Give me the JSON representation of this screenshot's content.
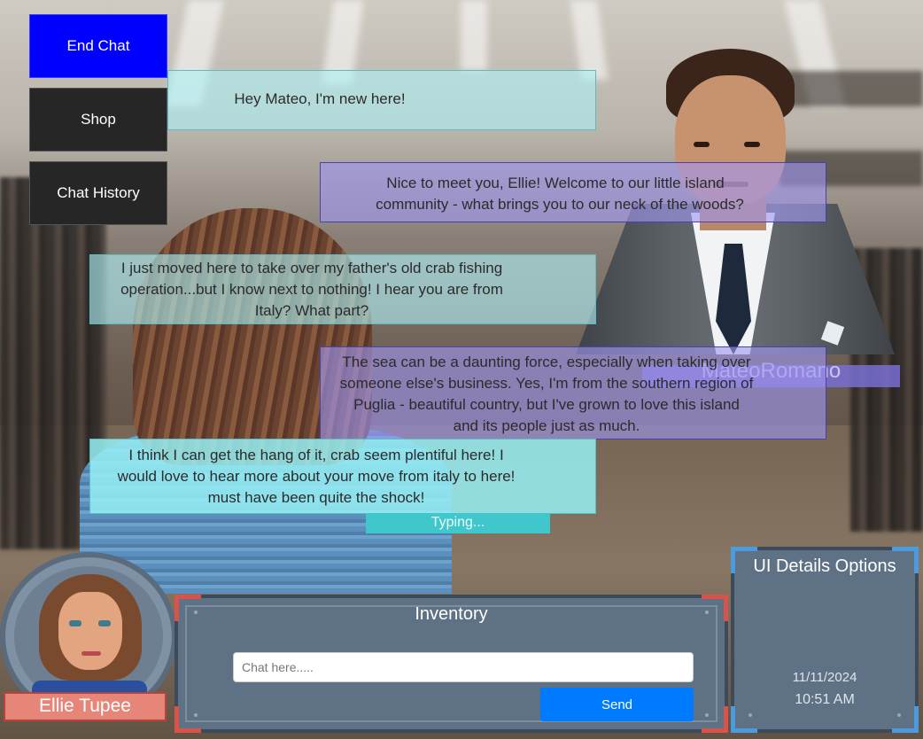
{
  "menu": {
    "end_chat": "End Chat",
    "shop": "Shop",
    "chat_history": "Chat History"
  },
  "chat": {
    "messages": [
      {
        "speaker": "user",
        "lines": [
          "Hey Mateo, I'm new here!"
        ]
      },
      {
        "speaker": "npc",
        "lines": [
          "Nice to meet you, Ellie! Welcome to our little island",
          "community - what brings you to our neck of the woods?"
        ]
      },
      {
        "speaker": "user",
        "lines": [
          "I just moved here to take over my father's old crab fishing",
          "operation...but I know next to nothing! I hear you are from",
          "Italy? What part?"
        ]
      },
      {
        "speaker": "npc",
        "lines": [
          "The sea can be a daunting force, especially when taking over",
          "someone else's business. Yes, I'm from the southern region of",
          "Puglia - beautiful country, but I've grown to love this island",
          "and its people just as much."
        ]
      },
      {
        "speaker": "user",
        "lines": [
          "I think I can get the hang of it, crab seem plentiful here! I",
          "would love to hear more about your move from italy to here!",
          "must have been quite the shock!"
        ]
      }
    ],
    "typing": "Typing..."
  },
  "npc": {
    "name": "MateoRomano"
  },
  "player": {
    "name": "Ellie Tupee"
  },
  "inventory": {
    "title": "Inventory",
    "input_placeholder": "Chat here.....",
    "input_value": "",
    "send_label": "Send"
  },
  "ui_panel": {
    "title": "UI Details Options",
    "date": "11/11/2024",
    "time": "10:51 AM"
  },
  "colors": {
    "end_chat_bg": "#0000ff",
    "menu_bg": "#262626",
    "user_bubble": "#aff0f5",
    "npc_bubble": "#a096f0",
    "send_button": "#007bff",
    "inventory_corner": "#d9534a",
    "ui_corner": "#4b9be0"
  }
}
